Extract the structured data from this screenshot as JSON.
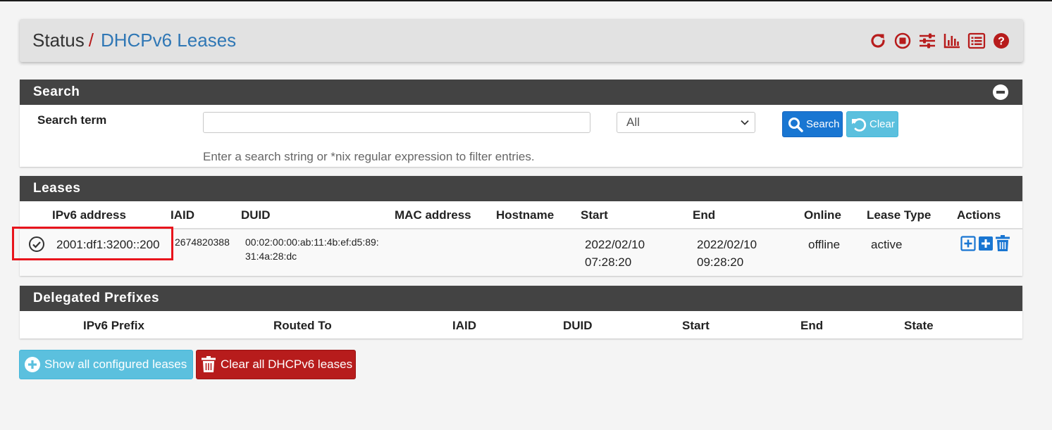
{
  "breadcrumb": {
    "parent": "Status",
    "separator": "/",
    "current": "DHCPv6 Leases"
  },
  "header_icons": [
    "reload-icon",
    "stop-icon",
    "sliders-icon",
    "bar-chart-icon",
    "log-list-icon",
    "help-icon"
  ],
  "colors": {
    "accent_red": "#b71c1c",
    "link_blue": "#2f77b5",
    "panel_heading": "#434343",
    "primary": "#1976d2",
    "info": "#5bc0de"
  },
  "search": {
    "title": "Search",
    "label": "Search term",
    "input_value": "",
    "select_value": "All",
    "search_button": "Search",
    "clear_button": "Clear",
    "help_text": "Enter a search string or *nix regular expression to filter entries."
  },
  "leases": {
    "title": "Leases",
    "columns": [
      "IPv6 address",
      "IAID",
      "DUID",
      "MAC address",
      "Hostname",
      "Start",
      "End",
      "Online",
      "Lease Type",
      "Actions"
    ],
    "rows": [
      {
        "ipv6": "2001:df1:3200::200",
        "iaid": "2674820388",
        "duid_line1": "00:02:00:00:ab:11:4b:ef:d5:89:",
        "duid_line2": "31:4a:28:dc",
        "mac": "",
        "hostname": "",
        "start_date": "2022/02/10",
        "start_time": "07:28:20",
        "end_date": "2022/02/10",
        "end_time": "09:28:20",
        "online": "offline",
        "lease_type": "active"
      }
    ]
  },
  "prefixes": {
    "title": "Delegated Prefixes",
    "columns": [
      "IPv6 Prefix",
      "Routed To",
      "IAID",
      "DUID",
      "Start",
      "End",
      "State"
    ]
  },
  "buttons": {
    "show_all": "Show all configured leases",
    "clear_all": "Clear all DHCPv6 leases"
  }
}
